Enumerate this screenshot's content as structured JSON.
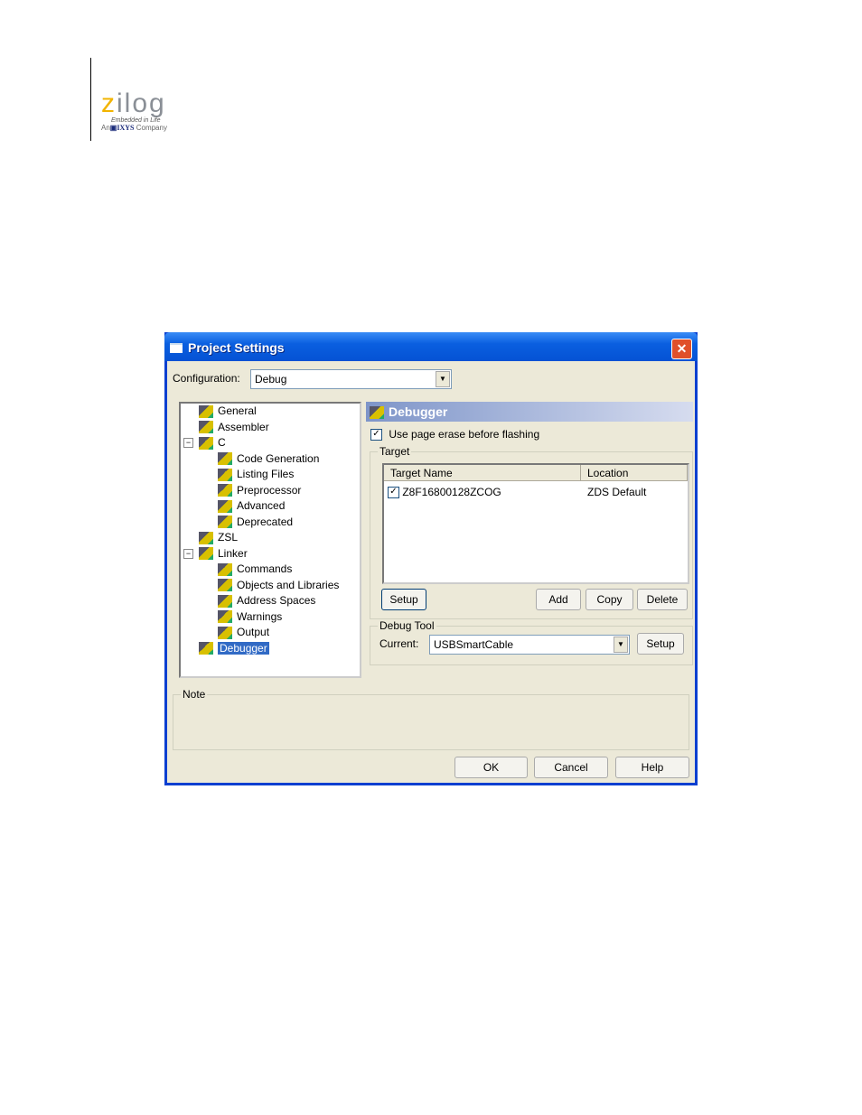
{
  "logo": {
    "brand": "zilog",
    "tagline": "Embedded in Life",
    "company_prefix": "An",
    "company_name": "IXYS",
    "company_suffix": "Company"
  },
  "dialog": {
    "title": "Project Settings",
    "close": "✕",
    "configuration_label": "Configuration:",
    "configuration_value": "Debug",
    "tree": [
      {
        "label": "General",
        "level": 0
      },
      {
        "label": "Assembler",
        "level": 0
      },
      {
        "label": "C",
        "level": 0,
        "expander": "−"
      },
      {
        "label": "Code Generation",
        "level": 1
      },
      {
        "label": "Listing Files",
        "level": 1
      },
      {
        "label": "Preprocessor",
        "level": 1
      },
      {
        "label": "Advanced",
        "level": 1
      },
      {
        "label": "Deprecated",
        "level": 1
      },
      {
        "label": "ZSL",
        "level": 0
      },
      {
        "label": "Linker",
        "level": 0,
        "expander": "−"
      },
      {
        "label": "Commands",
        "level": 1
      },
      {
        "label": "Objects and Libraries",
        "level": 1
      },
      {
        "label": "Address Spaces",
        "level": 1
      },
      {
        "label": "Warnings",
        "level": 1
      },
      {
        "label": "Output",
        "level": 1
      },
      {
        "label": "Debugger",
        "level": 0,
        "selected": true
      }
    ],
    "panel_title": "Debugger",
    "page_erase_label": "Use page erase before flashing",
    "page_erase_checked": true,
    "target_group": "Target",
    "target_columns": [
      "Target Name",
      "Location"
    ],
    "targets": [
      {
        "name": "Z8F16800128ZCOG",
        "location": "ZDS Default",
        "checked": true
      }
    ],
    "target_buttons": {
      "setup": "Setup",
      "add": "Add",
      "copy": "Copy",
      "delete": "Delete"
    },
    "debug_tool_group": "Debug Tool",
    "current_label": "Current:",
    "current_value": "USBSmartCable",
    "debug_setup": "Setup",
    "note_group": "Note",
    "buttons": {
      "ok": "OK",
      "cancel": "Cancel",
      "help": "Help"
    }
  }
}
